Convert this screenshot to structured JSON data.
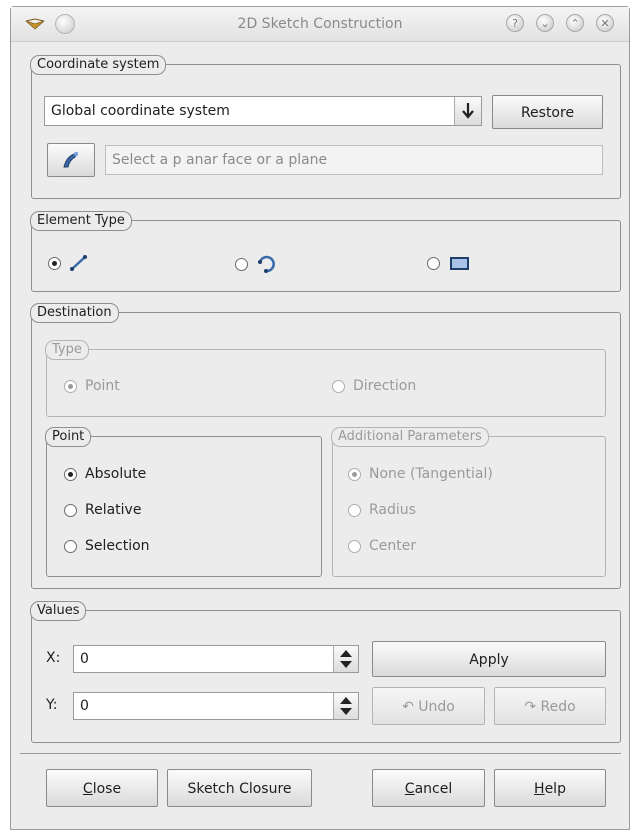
{
  "window": {
    "title": "2D Sketch Construction",
    "controls": [
      "help-icon",
      "minimize-icon",
      "maximize-icon",
      "close-icon"
    ]
  },
  "coordinate_system": {
    "title": "Coordinate system",
    "combo_value": "Global coordinate system",
    "restore_label": "Restore",
    "selection_placeholder": "Select a p anar face or a plane"
  },
  "element_type": {
    "title": "Element Type",
    "options": [
      {
        "icon": "segment-icon",
        "checked": true
      },
      {
        "icon": "arc-icon",
        "checked": false
      },
      {
        "icon": "rectangle-icon",
        "checked": false
      }
    ]
  },
  "destination": {
    "title": "Destination",
    "type": {
      "title": "Type",
      "options": [
        {
          "label": "Point",
          "checked": true
        },
        {
          "label": "Direction",
          "checked": false
        }
      ]
    },
    "point": {
      "title": "Point",
      "options": [
        {
          "label": "Absolute",
          "checked": true
        },
        {
          "label": "Relative",
          "checked": false
        },
        {
          "label": "Selection",
          "checked": false
        }
      ]
    },
    "additional": {
      "title": "Additional Parameters",
      "options": [
        {
          "label": "None (Tangential)",
          "checked": true
        },
        {
          "label": "Radius",
          "checked": false
        },
        {
          "label": "Center",
          "checked": false
        }
      ]
    }
  },
  "values": {
    "title": "Values",
    "x_label": "X:",
    "x_value": "0",
    "y_label": "Y:",
    "y_value": "0",
    "apply_label": "Apply",
    "undo_label": "Undo",
    "redo_label": "Redo"
  },
  "footer": {
    "close_label": "lose",
    "close_mnemonic": "C",
    "sketch_closure_label": "Sketch Closure",
    "cancel_label": "ancel",
    "cancel_mnemonic": "C",
    "help_label": "elp",
    "help_mnemonic": "H"
  },
  "colors": {
    "window_bg": "#ececec",
    "border": "#8f8f8f",
    "disabled_text": "#9a9a9a",
    "icon_blue": "#3a6aa8"
  }
}
